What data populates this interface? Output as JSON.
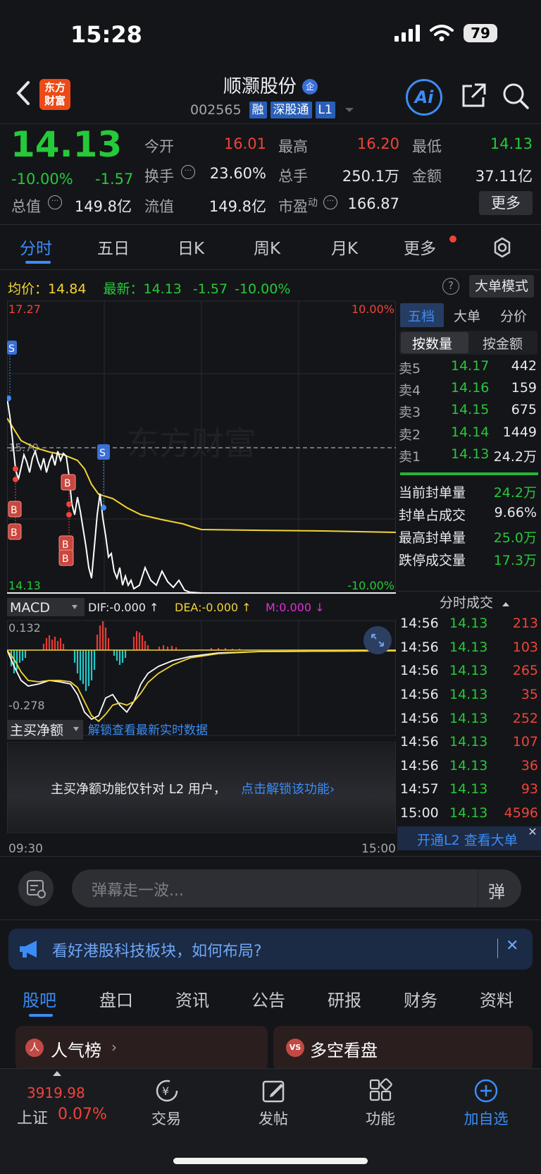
{
  "status": {
    "time": "15:28",
    "battery": "79"
  },
  "header": {
    "logo_line1": "东方",
    "logo_line2": "财富",
    "name": "顺灏股份",
    "name_badge": "企",
    "code": "002565",
    "tags": [
      "融",
      "深股通",
      "L1"
    ],
    "ai": "Ai"
  },
  "quote": {
    "price": "14.13",
    "change_pct": "-10.00%",
    "change": "-1.57",
    "open_label": "今开",
    "open": "16.01",
    "high_label": "最高",
    "high": "16.20",
    "low_label": "最低",
    "low": "14.13",
    "turnover_label": "换手",
    "turnover": "23.60%",
    "volume_label": "总手",
    "volume": "250.1万",
    "amount_label": "金额",
    "amount": "37.11亿",
    "mktcap_label": "总值",
    "mktcap": "149.8亿",
    "float_label": "流值",
    "float": "149.8亿",
    "pe_label": "市盈",
    "pe_sup": "动",
    "pe": "166.87",
    "more": "更多"
  },
  "tabs": [
    "分时",
    "五日",
    "日K",
    "周K",
    "月K",
    "更多"
  ],
  "chart": {
    "avg_label": "均价：",
    "avg": "14.84",
    "latest_label": "最新：",
    "latest": "14.13",
    "latest_change": "-1.57",
    "latest_pct": "-10.00%",
    "big_order_mode": "大单模式",
    "top_price": "17.27",
    "top_pct": "10.00%",
    "ref_price": "15.70",
    "bottom_price": "14.13",
    "bottom_pct": "-10.00%",
    "watermark": "东方财富",
    "time_start": "09:30",
    "time_end": "15:00",
    "markers": {
      "sell": "S",
      "buy": "B"
    },
    "colors": {
      "price_line": "#ffffff",
      "avg_line": "#f2d535",
      "up": "#f0433a",
      "down": "#25c93a"
    }
  },
  "macd": {
    "label": "MACD",
    "dif": "DIF:-0.000 ↑",
    "dea": "DEA:-0.000 ↑",
    "m": "M:0.000 ↓",
    "top": "0.132",
    "bottom": "-0.278"
  },
  "main_net": {
    "label": "主买净额",
    "unlock_link": "解锁查看最新实时数据",
    "notice": "主买净额功能仅针对 L2 用户，",
    "notice_link": "点击解锁该功能›"
  },
  "orderbook": {
    "tabs": [
      "五档",
      "大单",
      "分价"
    ],
    "subtabs": [
      "按数量",
      "按金额"
    ],
    "asks": [
      {
        "label": "卖5",
        "price": "14.17",
        "qty": "442"
      },
      {
        "label": "卖4",
        "price": "14.16",
        "qty": "159"
      },
      {
        "label": "卖3",
        "price": "14.15",
        "qty": "675"
      },
      {
        "label": "卖2",
        "price": "14.14",
        "qty": "1449"
      },
      {
        "label": "卖1",
        "price": "14.13",
        "qty": "24.2万"
      }
    ],
    "stats": [
      {
        "label": "当前封单量",
        "value": "24.2万"
      },
      {
        "label": "封单占成交",
        "value": "9.66%"
      },
      {
        "label": "最高封单量",
        "value": "25.0万"
      },
      {
        "label": "跌停成交量",
        "value": "17.3万"
      }
    ],
    "trades_title": "分时成交",
    "trades": [
      {
        "time": "14:56",
        "price": "14.13",
        "vol": "213"
      },
      {
        "time": "14:56",
        "price": "14.13",
        "vol": "103"
      },
      {
        "time": "14:56",
        "price": "14.13",
        "vol": "265"
      },
      {
        "time": "14:56",
        "price": "14.13",
        "vol": "35"
      },
      {
        "time": "14:56",
        "price": "14.13",
        "vol": "252"
      },
      {
        "time": "14:56",
        "price": "14.13",
        "vol": "107"
      },
      {
        "time": "14:56",
        "price": "14.13",
        "vol": "36"
      },
      {
        "time": "14:57",
        "price": "14.13",
        "vol": "93"
      },
      {
        "time": "15:00",
        "price": "14.13",
        "vol": "4596"
      }
    ],
    "l2_banner": "开通L2 查看大单"
  },
  "comment": {
    "placeholder": "弹幕走一波...",
    "danmu": "弹"
  },
  "news_banner": {
    "text": "看好港股科技板块，如何布局?"
  },
  "bottom_tabs": [
    "股吧",
    "盘口",
    "资讯",
    "公告",
    "研报",
    "财务",
    "资料"
  ],
  "cards": [
    {
      "icon": "人",
      "title": "人气榜"
    },
    {
      "icon": "VS",
      "title": "多空看盘"
    }
  ],
  "nav": {
    "index_value": "3919.98",
    "index_name": "上证",
    "index_change": "0.07%",
    "items": [
      "交易",
      "发帖",
      "功能",
      "加自选"
    ]
  }
}
